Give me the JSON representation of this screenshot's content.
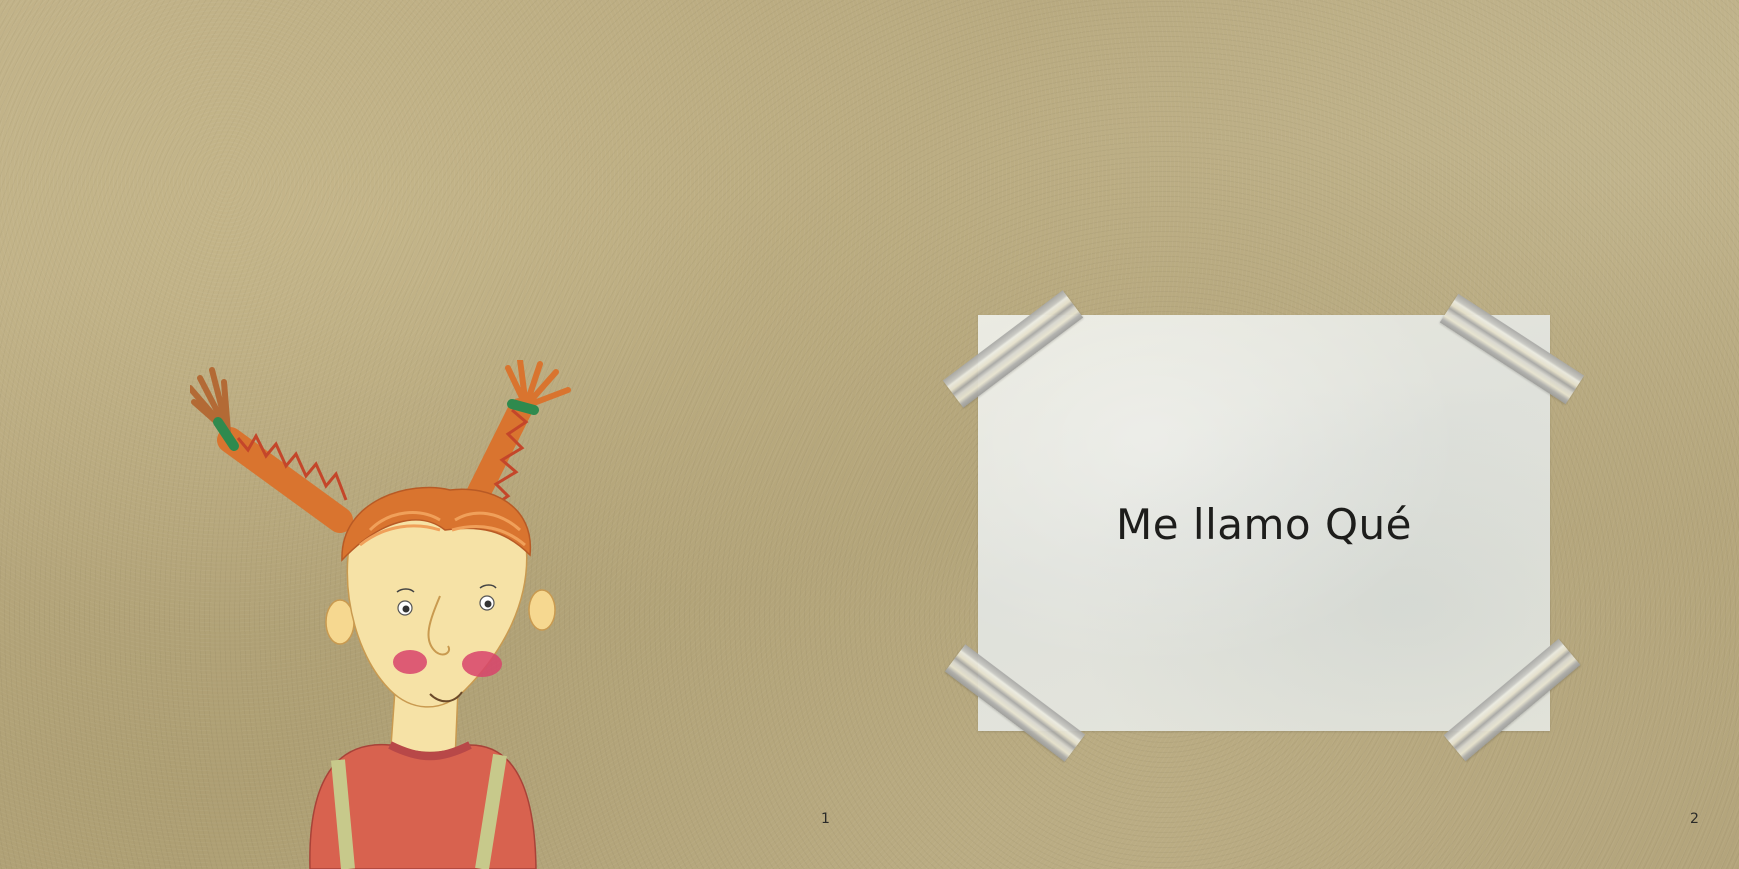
{
  "spread": {
    "title": "Me llamo Qué",
    "page_left": "1",
    "page_right": "2"
  },
  "illustration": {
    "subject": "girl-with-pigtails-illustration"
  },
  "colors": {
    "background": "#b8aa80",
    "note_paper": "#e3e4dc",
    "hair": "#d9742f",
    "skin": "#f6e2a6",
    "cheeks": "#d8436b",
    "shirt": "#d8624f",
    "suspenders": "#c7c98b",
    "hair_ties": "#2f8a4e"
  }
}
